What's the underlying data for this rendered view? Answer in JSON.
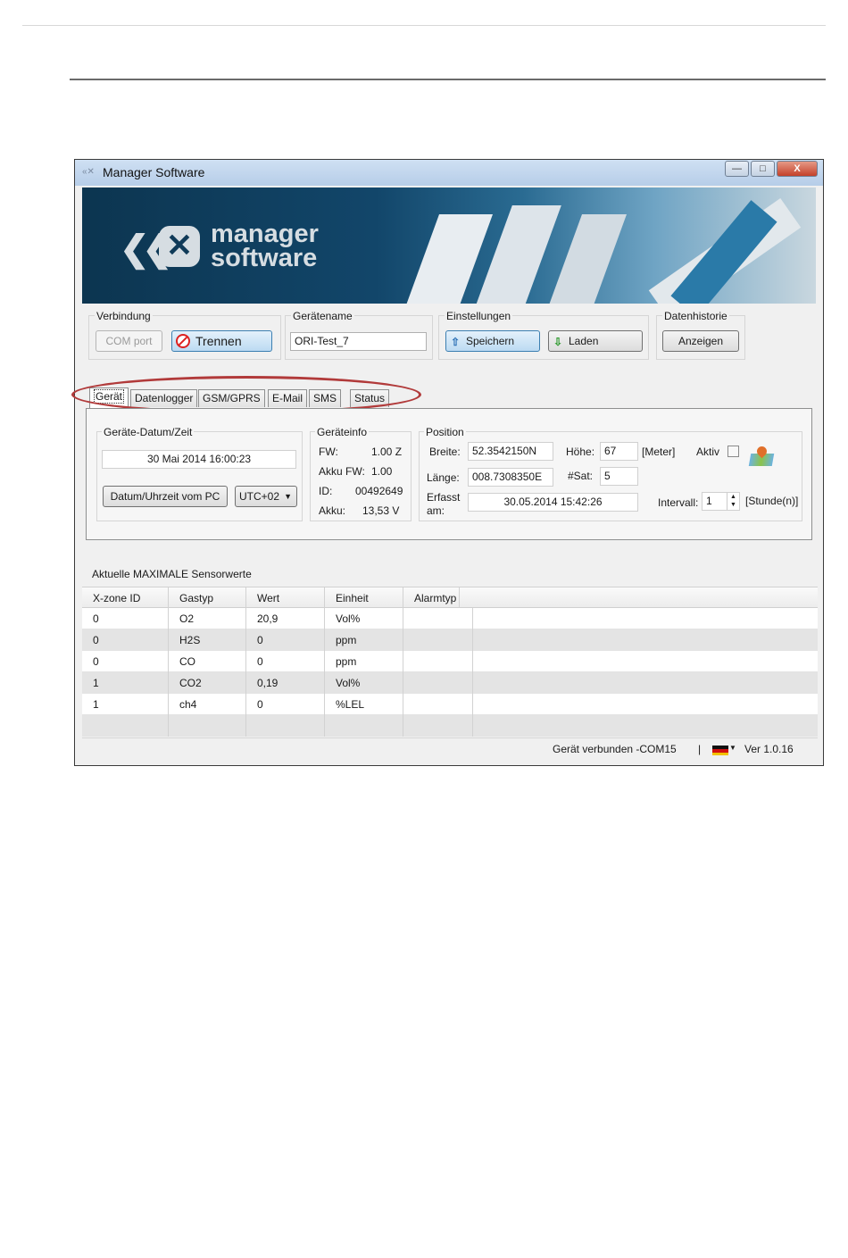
{
  "window": {
    "title": "Manager Software",
    "title_icon": "app-icon",
    "buttons": {
      "minimize": "—",
      "maximize": "□",
      "close": "X"
    }
  },
  "banner": {
    "logo_line1": "manager",
    "logo_line2": "software",
    "logo_glyph": "✕",
    "logo_chevrons": "❮❮"
  },
  "verbindung": {
    "label": "Verbindung",
    "comport_label": "COM port",
    "trennen_label": "Trennen"
  },
  "geraetename": {
    "label": "Gerätename",
    "value": "ORI-Test_7"
  },
  "einstellungen": {
    "label": "Einstellungen",
    "speichern_label": "Speichern",
    "laden_label": "Laden"
  },
  "datenhistorie": {
    "label": "Datenhistorie",
    "anzeigen_label": "Anzeigen"
  },
  "tabs": [
    "Gerät",
    "Datenlogger",
    "GSM/GPRS",
    "E-Mail",
    "SMS",
    "Status"
  ],
  "datum": {
    "label": "Geräte-Datum/Zeit",
    "value": "30 Mai 2014   16:00:23",
    "button_label": "Datum/Uhrzeit vom PC",
    "utc_value": "UTC+02"
  },
  "geraeteinfo": {
    "label": "Geräteinfo",
    "rows": [
      {
        "key": "FW:",
        "value": "1.00 Z"
      },
      {
        "key": "Akku FW:",
        "value": "1.00"
      },
      {
        "key": "ID:",
        "value": "00492649"
      },
      {
        "key": "Akku:",
        "value": "13,53 V"
      }
    ]
  },
  "position": {
    "label": "Position",
    "breite_label": "Breite:",
    "breite_value": "52.3542150N",
    "laenge_label": "Länge:",
    "laenge_value": "008.7308350E",
    "hoehe_label": "Höhe:",
    "hoehe_value": "67",
    "hoehe_unit": "[Meter]",
    "sat_label": "#Sat:",
    "sat_value": "5",
    "aktiv_label": "Aktiv",
    "erfasst_label1": "Erfasst",
    "erfasst_label2": "am:",
    "erfasst_value": "30.05.2014 15:42:26",
    "intervall_label": "Intervall:",
    "intervall_value": "1",
    "intervall_unit": "[Stunde(n)]"
  },
  "sensor": {
    "title": "Aktuelle MAXIMALE Sensorwerte",
    "columns": [
      "X-zone ID",
      "Gastyp",
      "Wert",
      "Einheit",
      "Alarmtyp"
    ],
    "rows": [
      [
        "0",
        "O2",
        "20,9",
        "Vol%",
        ""
      ],
      [
        "0",
        "H2S",
        "0",
        "ppm",
        ""
      ],
      [
        "0",
        "CO",
        "0",
        "ppm",
        ""
      ],
      [
        "1",
        "CO2",
        "0,19",
        "Vol%",
        ""
      ],
      [
        "1",
        "ch4",
        "0",
        "%LEL",
        ""
      ]
    ]
  },
  "status": {
    "connection": "Gerät verbunden -COM15",
    "separator": "|",
    "version": "Ver  1.0.16"
  },
  "colors": {
    "highlight_ellipse": "#b13a3a",
    "banner_dark": "#0c3550"
  }
}
